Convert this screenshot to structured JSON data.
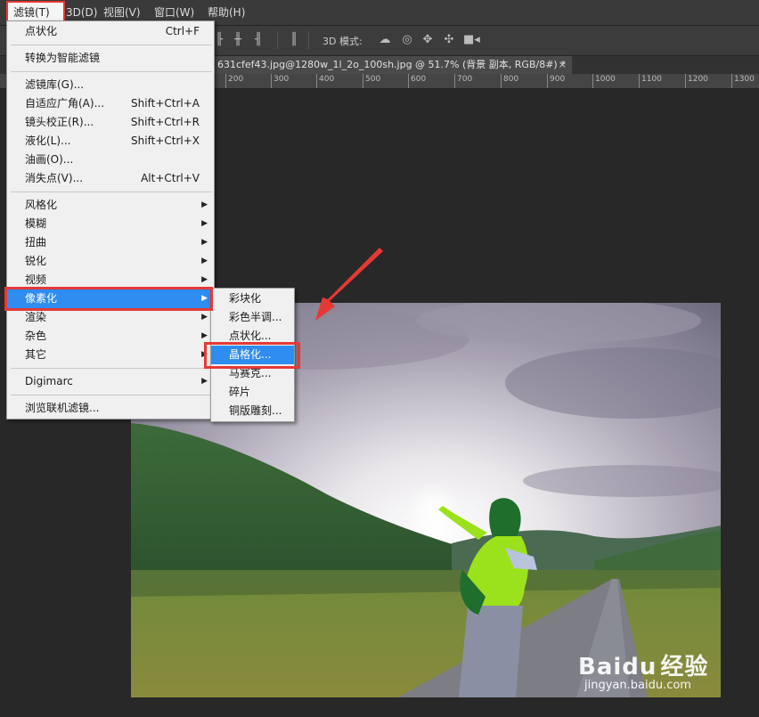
{
  "menubar": {
    "filter": "滤镜(T)",
    "three_d": "3D(D)",
    "view": "视图(V)",
    "window": "窗口(W)",
    "help": "帮助(H)"
  },
  "options_bar": {
    "mode_label": "3D 模式:"
  },
  "document_tab": {
    "title": "631cfef43.jpg@1280w_1l_2o_100sh.jpg @ 51.7% (背景 副本, RGB/8#) *",
    "close": "×"
  },
  "ruler": {
    "labels": [
      "200",
      "300",
      "400",
      "500",
      "600",
      "700",
      "800",
      "900",
      "1000",
      "1100",
      "1200",
      "1300"
    ]
  },
  "filter_menu": {
    "items": [
      {
        "label": "点状化",
        "shortcut": "Ctrl+F"
      },
      {
        "label": "转换为智能滤镜"
      },
      {
        "label": "滤镜库(G)..."
      },
      {
        "label": "自适应广角(A)...",
        "shortcut": "Shift+Ctrl+A"
      },
      {
        "label": "镜头校正(R)...",
        "shortcut": "Shift+Ctrl+R"
      },
      {
        "label": "液化(L)...",
        "shortcut": "Shift+Ctrl+X"
      },
      {
        "label": "油画(O)..."
      },
      {
        "label": "消失点(V)...",
        "shortcut": "Alt+Ctrl+V"
      },
      {
        "label": "风格化"
      },
      {
        "label": "模糊"
      },
      {
        "label": "扭曲"
      },
      {
        "label": "锐化"
      },
      {
        "label": "视频"
      },
      {
        "label": "像素化"
      },
      {
        "label": "渲染"
      },
      {
        "label": "杂色"
      },
      {
        "label": "其它"
      },
      {
        "label": "Digimarc"
      },
      {
        "label": "浏览联机滤镜..."
      }
    ]
  },
  "pixelate_submenu": {
    "items": [
      "彩块化",
      "彩色半调...",
      "点状化...",
      "晶格化...",
      "马赛克...",
      "碎片",
      "铜版雕刻..."
    ]
  },
  "watermark": {
    "main": "Bai",
    "paw": "du",
    "cn": "经验",
    "url": "jingyan.baidu.com"
  },
  "colors": {
    "highlight": "#2f8cf0",
    "annotation_red": "#e53935"
  }
}
